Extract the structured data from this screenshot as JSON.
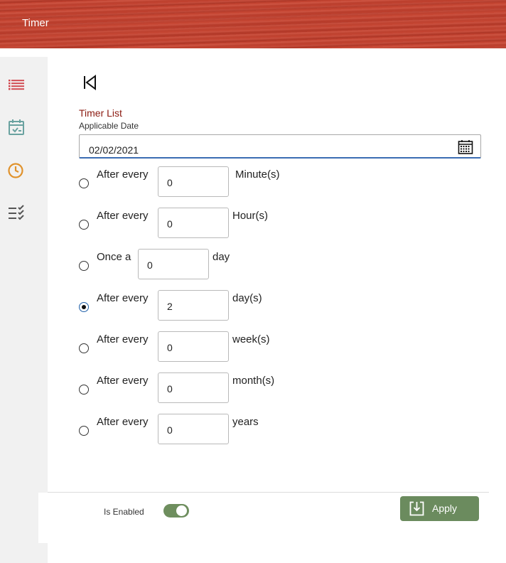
{
  "header": {
    "title": "Timer"
  },
  "sidebar": {
    "items": [
      {
        "icon": "list-icon",
        "color": "#d0434a"
      },
      {
        "icon": "calendar-check-icon",
        "color": "#6aa2a0"
      },
      {
        "icon": "clock-icon",
        "color": "#e0922c"
      },
      {
        "icon": "checklist-icon",
        "color": "#555555"
      }
    ]
  },
  "main": {
    "section_title": "Timer List",
    "date_label": "Applicable Date",
    "date_value": "02/02/2021",
    "options": [
      {
        "prefix": "After every",
        "value": "0",
        "unit": "Minute(s)",
        "selected": false
      },
      {
        "prefix": "After every",
        "value": "0",
        "unit": "Hour(s)",
        "selected": false
      },
      {
        "prefix": "Once a",
        "value": "0",
        "unit": "day",
        "selected": false
      },
      {
        "prefix": "After every",
        "value": "2",
        "unit": "day(s)",
        "selected": true
      },
      {
        "prefix": "After every",
        "value": "0",
        "unit": "week(s)",
        "selected": false
      },
      {
        "prefix": "After every",
        "value": "0",
        "unit": "month(s)",
        "selected": false
      },
      {
        "prefix": "After every",
        "value": "0",
        "unit": "years",
        "selected": false
      }
    ]
  },
  "footer": {
    "enabled_label": "Is Enabled",
    "enabled": true,
    "apply_label": "Apply"
  },
  "colors": {
    "accent": "#8b1a10",
    "header": "#c2412f",
    "button": "#6b8b5e"
  }
}
